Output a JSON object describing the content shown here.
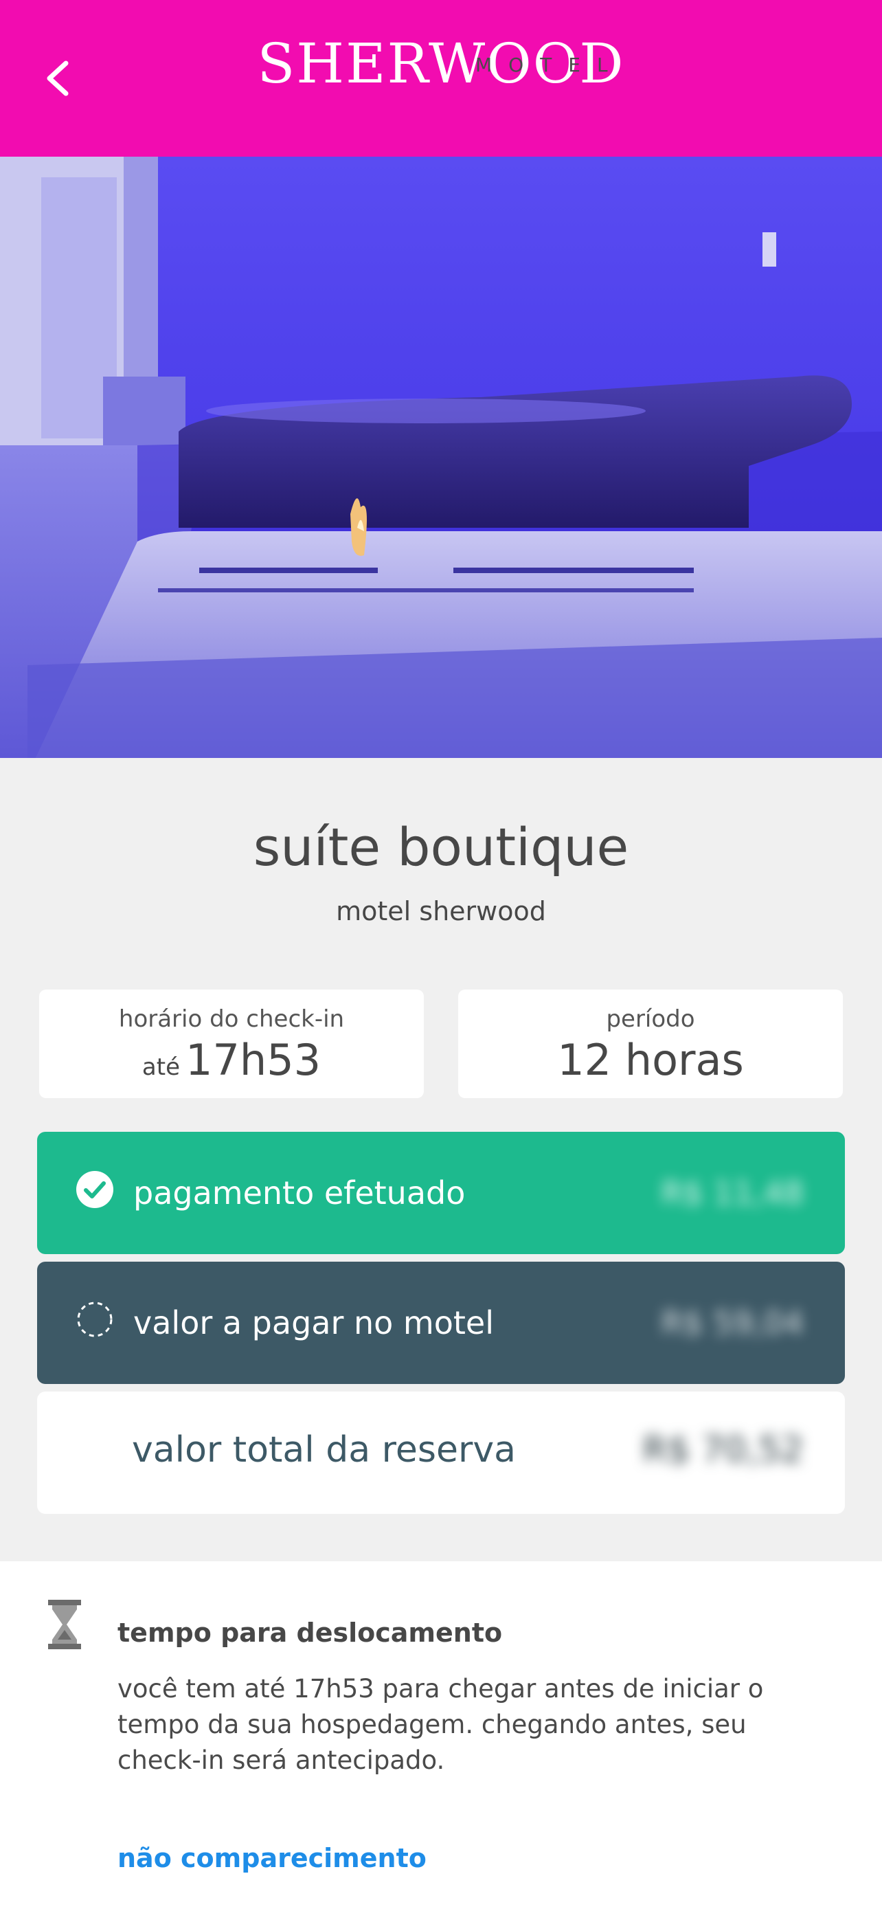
{
  "header": {
    "logo_main": "SHERWOOD",
    "logo_sub": "MOTEL",
    "background_color": "#f20cb0",
    "back_icon": "chevron-left-icon"
  },
  "hero": {
    "description_icon": "suite-photo"
  },
  "suite": {
    "title": "suíte boutique",
    "subtitle": "motel sherwood"
  },
  "checkin": {
    "label": "horário do check-in",
    "prefix": "até",
    "value": "17h53"
  },
  "period": {
    "label": "período",
    "value": "12 horas"
  },
  "payments": {
    "paid": {
      "label": "pagamento efetuado",
      "value": "R$ 11,48",
      "icon": "check-circle-icon",
      "color": "#1dba8e"
    },
    "due": {
      "label": "valor a pagar no motel",
      "value": "R$ 59,04",
      "icon": "dashed-circle-icon",
      "color": "#3d5966"
    },
    "total": {
      "label": "valor total da reserva",
      "value": "R$ 70,52"
    }
  },
  "travel": {
    "icon": "hourglass-icon",
    "title": "tempo para deslocamento",
    "text": "você tem até 17h53 para chegar antes de iniciar o tempo da sua hospedagem. chegando antes, seu check-in será antecipado.",
    "no_show_link": "não comparecimento"
  }
}
